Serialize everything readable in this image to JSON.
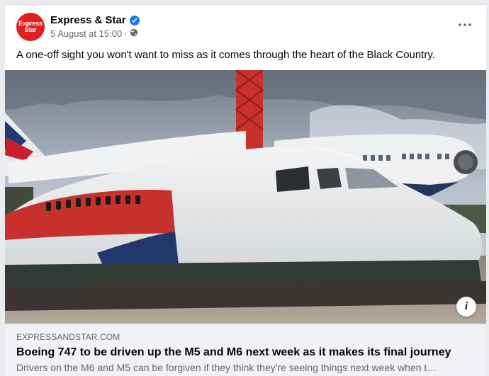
{
  "post": {
    "avatar": {
      "line1": "Express",
      "line2": "Star"
    },
    "page_name": "Express & Star",
    "timestamp": "5 August at 15:00",
    "separator": "·",
    "privacy_icon": "globe-icon",
    "more_icon": "more-options-icon",
    "caption": "A one-off sight you won't want to miss as it comes through the heart of the Black Country."
  },
  "link_preview": {
    "domain": "EXPRESSANDSTAR.COM",
    "headline": "Boeing 747 to be driven up the M5 and M6 next week as it makes its final journey",
    "description": "Drivers on the M6 and M5 can be forgiven if they think they're seeing things next week when t…",
    "info_icon": "info-icon",
    "info_label": "i"
  },
  "colors": {
    "avatar_red": "#e02020",
    "verified_blue": "#1877f2",
    "link_box_bg": "#f0f2f5"
  }
}
